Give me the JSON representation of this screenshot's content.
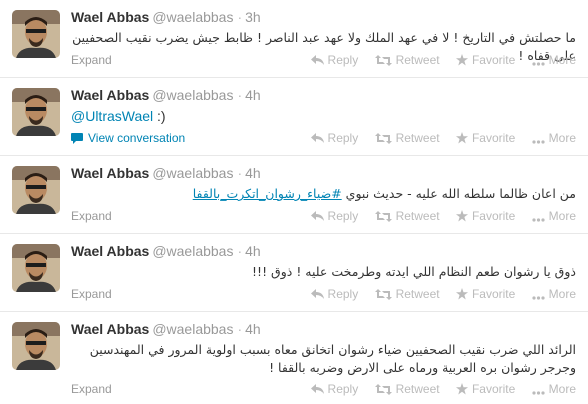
{
  "tweets": [
    {
      "name": "Wael Abbas",
      "handle": "@waelabbas",
      "separator": "·",
      "time": "3h",
      "text": "ما حصلتش في التاريخ ! لا في عهد الملك ولا عهد عبد الناصر ! ظابط جيش يضرب نقيب الصحفيين على قفاه !",
      "footer": "Expand"
    },
    {
      "name": "Wael Abbas",
      "handle": "@waelabbas",
      "separator": "·",
      "time": "4h",
      "mention": "@UltrasWael",
      "text_after": " :)",
      "footer": "View conversation"
    },
    {
      "name": "Wael Abbas",
      "handle": "@waelabbas",
      "separator": "·",
      "time": "4h",
      "text_before": "من اعان ظالما سلطه الله عليه - حديث نبوي ",
      "hashtag": "#ضياء_رشوان_اتكرت_بالقفا",
      "footer": "Expand"
    },
    {
      "name": "Wael Abbas",
      "handle": "@waelabbas",
      "separator": "·",
      "time": "4h",
      "text": "ذوق يا رشوان طعم النظام اللي ايدته وطرمخت عليه ! ذوق !!!",
      "footer": "Expand"
    },
    {
      "name": "Wael Abbas",
      "handle": "@waelabbas",
      "separator": "·",
      "time": "4h",
      "text": "الرائد اللي ضرب نقيب الصحفيين ضياء رشوان اتخانق معاه بسبب اولوية المرور في المهندسين وجرجر رشوان بره العربية ورماه على الارض وضربه بالقفا !",
      "footer": "Expand"
    }
  ],
  "actions": {
    "reply": "Reply",
    "retweet": "Retweet",
    "favorite": "Favorite",
    "more": "More"
  },
  "icons": {
    "reply": "reply-arrow-icon",
    "retweet": "retweet-icon",
    "favorite": "star-icon",
    "more": "ellipsis-icon",
    "conversation": "speech-bubble-icon"
  },
  "colors": {
    "link": "#0084b4",
    "muted": "#999999",
    "action": "#bbbbbb"
  }
}
